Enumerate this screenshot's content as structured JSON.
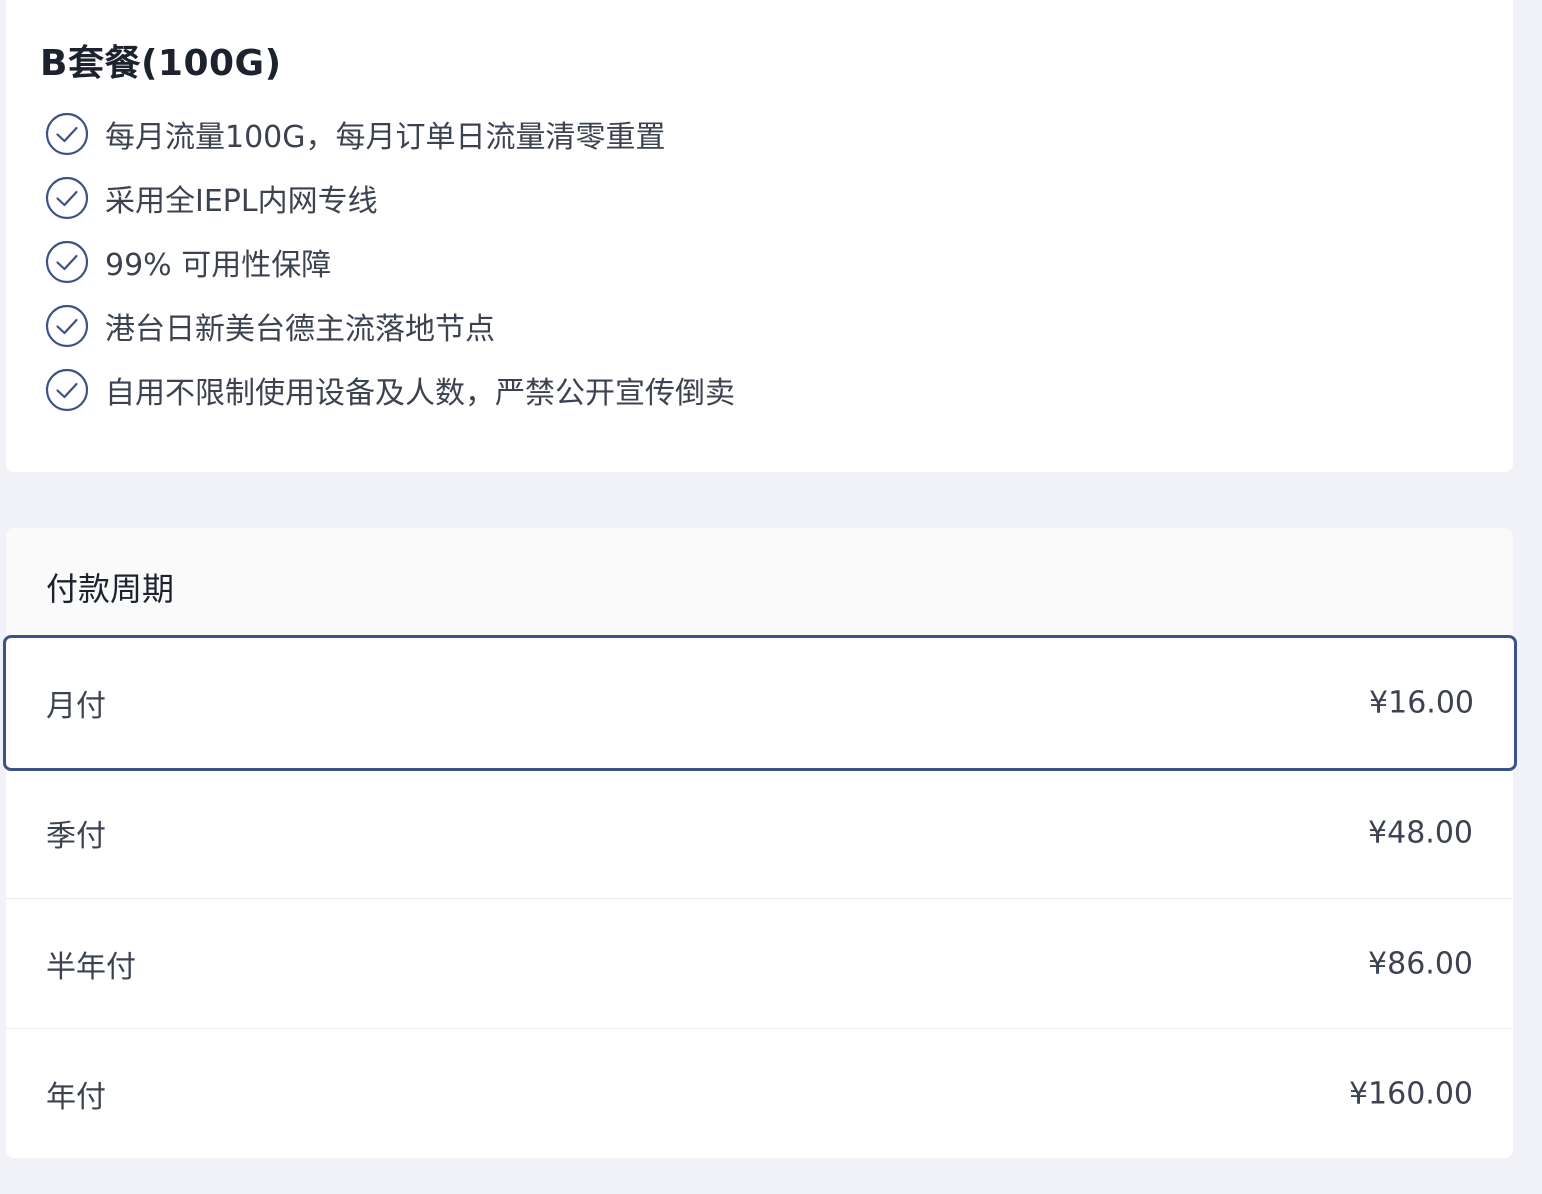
{
  "plan": {
    "title": "B套餐(100G)",
    "features": [
      {
        "icon": "check-circle-icon",
        "text": "每月流量100G，每月订单日流量清零重置"
      },
      {
        "icon": "check-circle-icon",
        "text": "采用全IEPL内网专线"
      },
      {
        "icon": "check-circle-icon",
        "text": "99% 可用性保障"
      },
      {
        "icon": "check-circle-icon",
        "text": "港台日新美台德主流落地节点"
      },
      {
        "icon": "check-circle-icon",
        "text": "自用不限制使用设备及人数，严禁公开宣传倒卖"
      }
    ]
  },
  "billing": {
    "title": "付款周期",
    "selected": "月付",
    "options": [
      {
        "label": "月付",
        "price": "¥16.00"
      },
      {
        "label": "季付",
        "price": "¥48.00"
      },
      {
        "label": "半年付",
        "price": "¥86.00"
      },
      {
        "label": "年付",
        "price": "¥160.00"
      }
    ]
  },
  "colors": {
    "page_background": "#f0f2f7",
    "card_background": "#ffffff",
    "accent": "#3d5189",
    "text": "#3c4350",
    "title_text": "#1c232e"
  }
}
